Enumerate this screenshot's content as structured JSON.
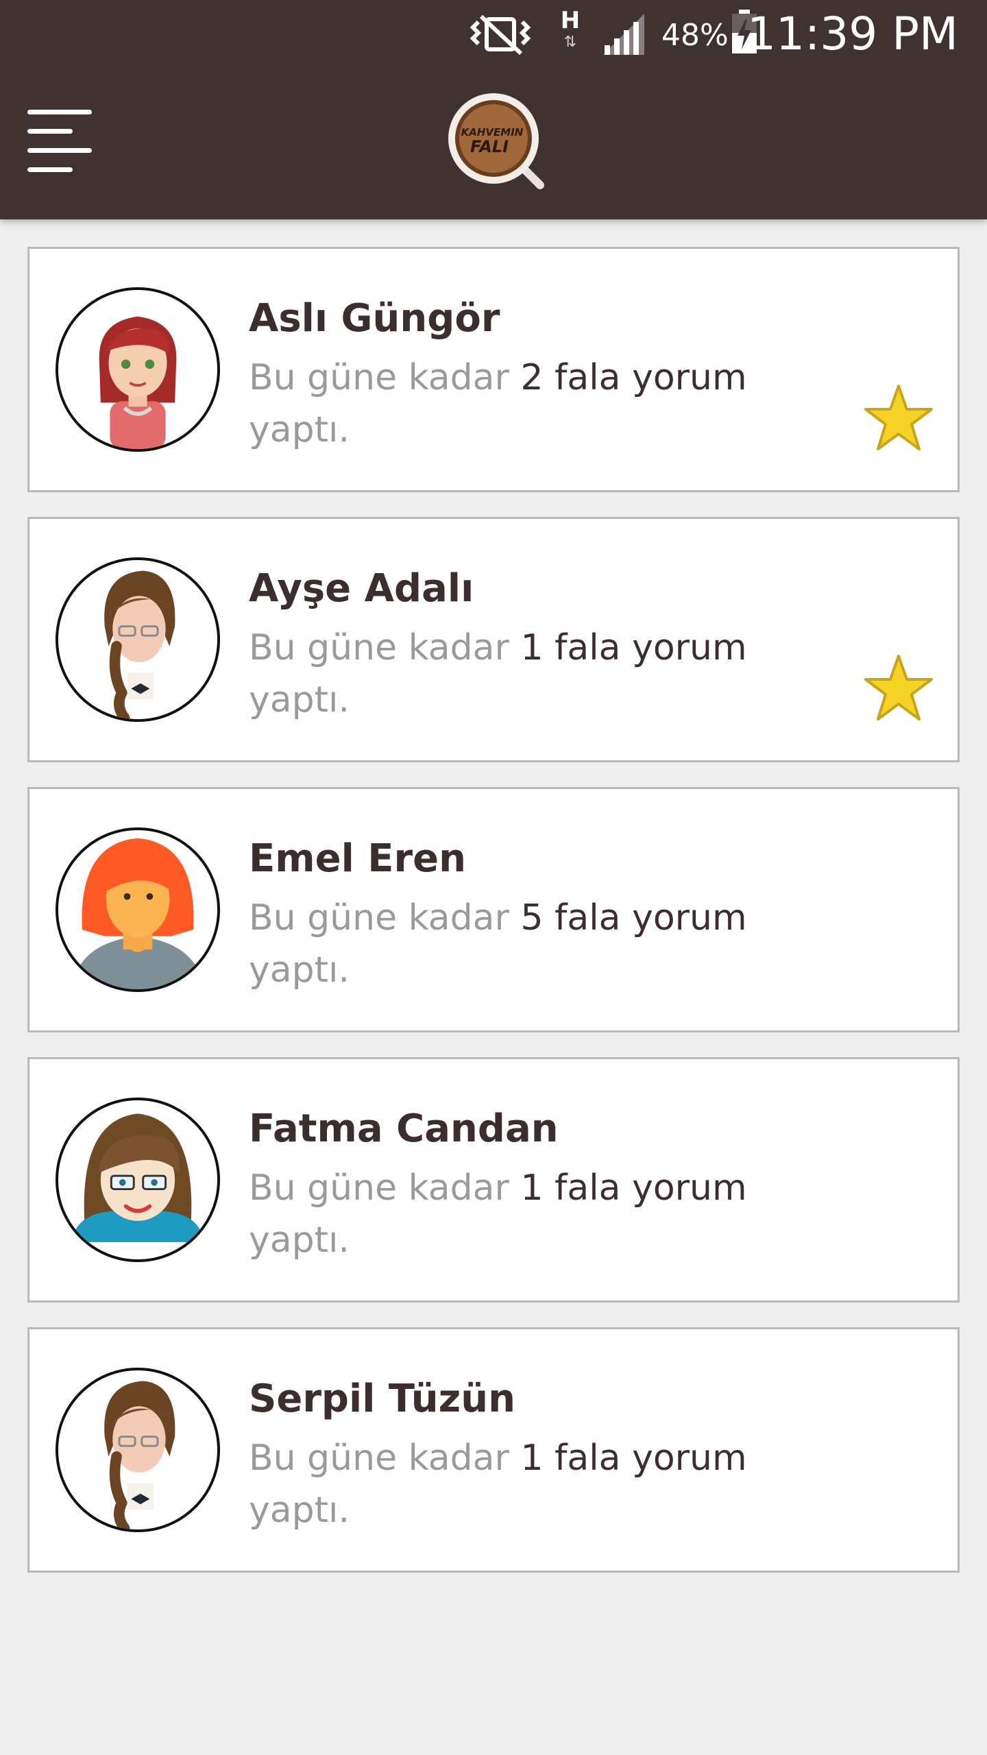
{
  "status_bar": {
    "battery_percent": "48%",
    "time": "11:39 PM",
    "network_type": "H"
  },
  "header": {
    "logo_line1": "KAHVEMIN",
    "logo_line2": "FALI"
  },
  "colors": {
    "header_bg": "#413232",
    "page_bg": "#eeeeee",
    "name_text": "#3c2e2e",
    "muted_text": "#9a9a9a",
    "star": "#f5d327"
  },
  "readers": [
    {
      "name": "Aslı Güngör",
      "desc_prefix": "Bu güne kadar",
      "desc_count": "2 fala yorum",
      "desc_suffix": "yaptı.",
      "avatar": "red-hair-woman-avatar",
      "favorite": true
    },
    {
      "name": "Ayşe Adalı",
      "desc_prefix": "Bu güne kadar",
      "desc_count": "1 fala yorum",
      "desc_suffix": "yaptı.",
      "avatar": "braid-glasses-woman-avatar",
      "favorite": true
    },
    {
      "name": "Emel Eren",
      "desc_prefix": "Bu güne kadar",
      "desc_count": "5 fala yorum",
      "desc_suffix": "yaptı.",
      "avatar": "orange-hair-woman-avatar",
      "favorite": false
    },
    {
      "name": "Fatma Candan",
      "desc_prefix": "Bu güne kadar",
      "desc_count": "1 fala yorum",
      "desc_suffix": "yaptı.",
      "avatar": "glasses-brown-hair-woman-avatar",
      "favorite": false
    },
    {
      "name": "Serpil Tüzün",
      "desc_prefix": "Bu güne kadar",
      "desc_count": "1 fala yorum",
      "desc_suffix": "yaptı.",
      "avatar": "braid-glasses-woman-avatar",
      "favorite": false
    }
  ]
}
